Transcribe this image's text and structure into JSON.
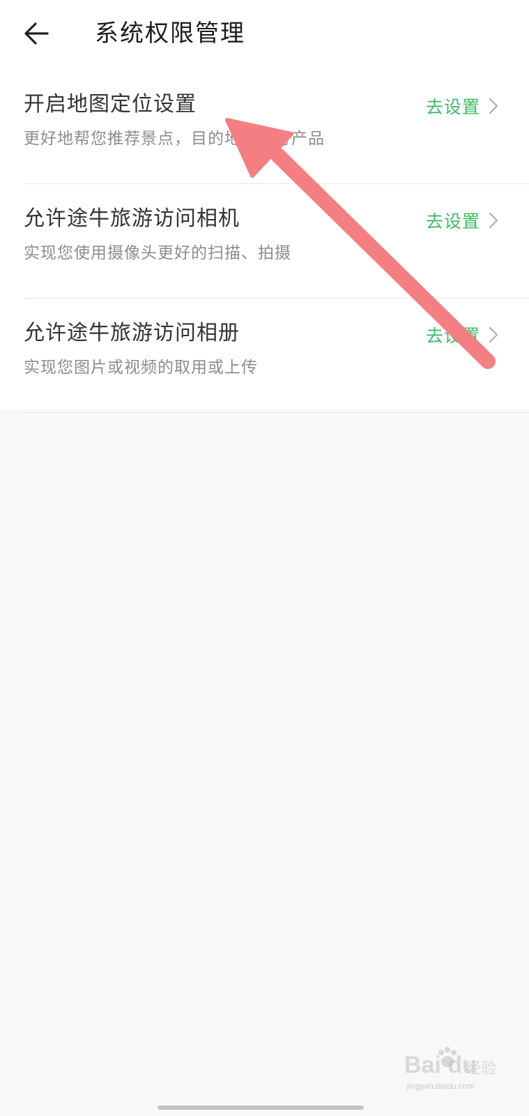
{
  "header": {
    "title": "系统权限管理",
    "back_icon": "arrow-left-icon"
  },
  "permissions": [
    {
      "title": "开启地图定位设置",
      "description": "更好地帮您推荐景点，目的地等旅行产品",
      "action": "去设置"
    },
    {
      "title": "允许途牛旅游访问相机",
      "description": "实现您使用摄像头更好的扫描、拍摄",
      "action": "去设置"
    },
    {
      "title": "允许途牛旅游访问相册",
      "description": "实现您图片或视频的取用或上传",
      "action": "去设置"
    }
  ],
  "watermark": {
    "logo": "Bai du",
    "brand": "经验",
    "url": "jingyan.baidu.com"
  },
  "colors": {
    "accent": "#3fb864",
    "annotation_arrow": "#f47f82",
    "title_text": "#333333",
    "desc_text": "#8c8c8c"
  }
}
